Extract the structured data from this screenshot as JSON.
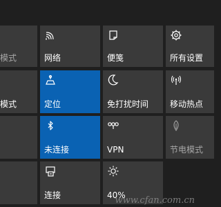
{
  "colors": {
    "background": "#1f1f1f",
    "tile": "#3a3a3a",
    "tile_active": "#0a62b3",
    "text": "#ffffff",
    "text_dim": "#a7a7a7"
  },
  "tiles": [
    {
      "label": "模式",
      "icon": "tablet-mode-icon",
      "active": false,
      "dim": true
    },
    {
      "label": "网络",
      "icon": "network-icon",
      "active": false,
      "dim": false
    },
    {
      "label": "便笺",
      "icon": "note-icon",
      "active": false,
      "dim": false
    },
    {
      "label": "所有设置",
      "icon": "gear-icon",
      "active": false,
      "dim": false
    },
    {
      "label": "模式",
      "icon": "mode-icon",
      "active": false,
      "dim": false
    },
    {
      "label": "定位",
      "icon": "location-icon",
      "active": true,
      "dim": false
    },
    {
      "label": "免打扰时间",
      "icon": "moon-icon",
      "active": false,
      "dim": false
    },
    {
      "label": "移动热点",
      "icon": "hotspot-icon",
      "active": false,
      "dim": false
    },
    {
      "label": "",
      "icon": "",
      "active": false,
      "dim": false
    },
    {
      "label": "未连接",
      "icon": "bluetooth-icon",
      "active": true,
      "dim": false
    },
    {
      "label": "VPN",
      "icon": "vpn-icon",
      "active": false,
      "dim": false
    },
    {
      "label": "节电模式",
      "icon": "battery-saver-icon",
      "active": false,
      "dim": true
    },
    {
      "label": "",
      "icon": "",
      "active": false,
      "dim": false
    },
    {
      "label": "连接",
      "icon": "connect-icon",
      "active": false,
      "dim": false
    },
    {
      "label": "40%",
      "icon": "brightness-icon",
      "active": false,
      "dim": false
    }
  ],
  "watermark": "www.cfan.com.cn"
}
